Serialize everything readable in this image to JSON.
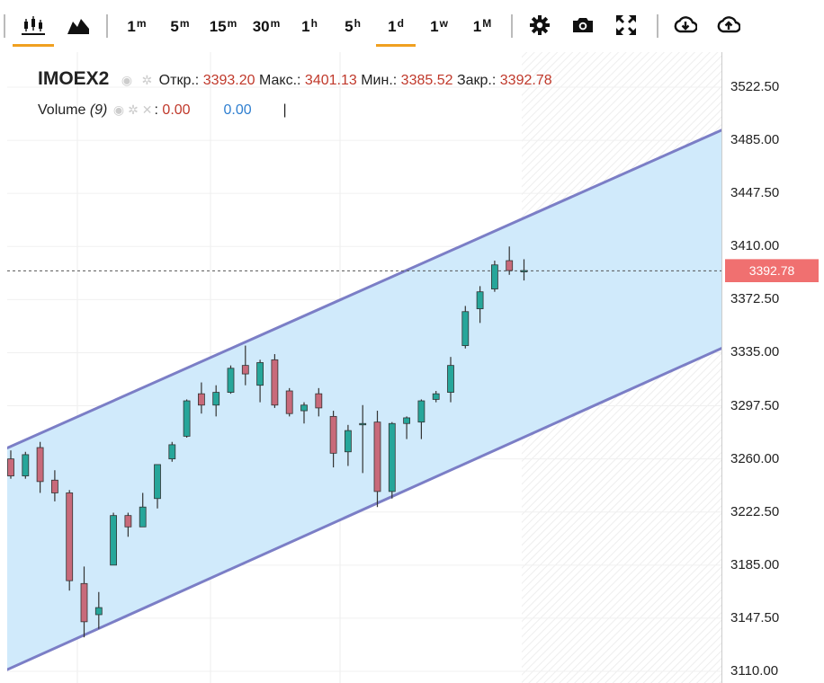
{
  "toolbar": {
    "chart_type_buttons": [
      {
        "icon": "candlestick-icon",
        "active": true
      },
      {
        "icon": "area-chart-icon",
        "active": false
      }
    ],
    "intervals": [
      {
        "main": "1",
        "sup": "m",
        "active": false
      },
      {
        "main": "5",
        "sup": "m",
        "active": false
      },
      {
        "main": "15",
        "sup": "m",
        "active": false
      },
      {
        "main": "30",
        "sup": "m",
        "active": false
      },
      {
        "main": "1",
        "sup": "h",
        "active": false
      },
      {
        "main": "5",
        "sup": "h",
        "active": false
      },
      {
        "main": "1",
        "sup": "d",
        "active": true
      },
      {
        "main": "1",
        "sup": "w",
        "active": false
      },
      {
        "main": "1",
        "sup": "M",
        "active": false
      }
    ],
    "tools": [
      "gear-icon",
      "camera-icon",
      "fullscreen-icon",
      "download-icon",
      "upload-icon"
    ]
  },
  "legend": {
    "symbol": "IMOEX2",
    "open_label": "Откр.:",
    "open": "3393.20",
    "high_label": "Макс.:",
    "high": "3401.13",
    "low_label": "Мин.:",
    "low": "3385.52",
    "close_label": "Закр.:",
    "close": "3392.78",
    "volume_label": "Volume",
    "volume_param": "(9)",
    "volume_value1": "0.00",
    "volume_value2": "0.00",
    "cursor": "|"
  },
  "axis": {
    "current_price": "3392.78",
    "ticks": [
      "3522.50",
      "3485.00",
      "3447.50",
      "3410.00",
      "3372.50",
      "3335.00",
      "3297.50",
      "3260.00",
      "3222.50",
      "3185.00",
      "3147.50",
      "3110.00"
    ]
  },
  "colors": {
    "up": "#26a69a",
    "down": "#c86a7a",
    "channel_fill": "#cde9fb",
    "channel_line": "#7b7ec6",
    "accent": "#f0a020",
    "price_tag": "#f07070"
  },
  "chart_data": {
    "type": "candlestick",
    "interval": "1d",
    "y_range": [
      3110.0,
      3522.5
    ],
    "candles": [
      {
        "o": 3260,
        "h": 3266,
        "l": 3246,
        "c": 3248
      },
      {
        "o": 3248,
        "h": 3265,
        "l": 3246,
        "c": 3263
      },
      {
        "o": 3268,
        "h": 3272,
        "l": 3236,
        "c": 3244
      },
      {
        "o": 3245,
        "h": 3252,
        "l": 3230,
        "c": 3236
      },
      {
        "o": 3236,
        "h": 3238,
        "l": 3167,
        "c": 3174
      },
      {
        "o": 3172,
        "h": 3184,
        "l": 3134,
        "c": 3145
      },
      {
        "o": 3150,
        "h": 3166,
        "l": 3140,
        "c": 3155
      },
      {
        "o": 3185,
        "h": 3222,
        "l": 3185,
        "c": 3220
      },
      {
        "o": 3220,
        "h": 3222,
        "l": 3205,
        "c": 3212
      },
      {
        "o": 3212,
        "h": 3236,
        "l": 3212,
        "c": 3226
      },
      {
        "o": 3232,
        "h": 3256,
        "l": 3225,
        "c": 3256
      },
      {
        "o": 3260,
        "h": 3272,
        "l": 3258,
        "c": 3270
      },
      {
        "o": 3276,
        "h": 3302,
        "l": 3275,
        "c": 3301
      },
      {
        "o": 3306,
        "h": 3314,
        "l": 3292,
        "c": 3298
      },
      {
        "o": 3298,
        "h": 3312,
        "l": 3290,
        "c": 3307
      },
      {
        "o": 3307,
        "h": 3326,
        "l": 3306,
        "c": 3324
      },
      {
        "o": 3326,
        "h": 3340,
        "l": 3312,
        "c": 3320
      },
      {
        "o": 3312,
        "h": 3330,
        "l": 3300,
        "c": 3328
      },
      {
        "o": 3330,
        "h": 3334,
        "l": 3296,
        "c": 3298
      },
      {
        "o": 3308,
        "h": 3310,
        "l": 3290,
        "c": 3292
      },
      {
        "o": 3294,
        "h": 3300,
        "l": 3285,
        "c": 3298
      },
      {
        "o": 3306,
        "h": 3310,
        "l": 3290,
        "c": 3296
      },
      {
        "o": 3290,
        "h": 3294,
        "l": 3254,
        "c": 3264
      },
      {
        "o": 3265,
        "h": 3284,
        "l": 3255,
        "c": 3280
      },
      {
        "o": 3285,
        "h": 3298,
        "l": 3250,
        "c": 3285
      },
      {
        "o": 3286,
        "h": 3294,
        "l": 3226,
        "c": 3237
      },
      {
        "o": 3237,
        "h": 3286,
        "l": 3232,
        "c": 3285
      },
      {
        "o": 3285,
        "h": 3290,
        "l": 3274,
        "c": 3289
      },
      {
        "o": 3286,
        "h": 3302,
        "l": 3274,
        "c": 3301
      },
      {
        "o": 3302,
        "h": 3308,
        "l": 3300,
        "c": 3306
      },
      {
        "o": 3307,
        "h": 3332,
        "l": 3300,
        "c": 3326
      },
      {
        "o": 3340,
        "h": 3368,
        "l": 3338,
        "c": 3364
      },
      {
        "o": 3366,
        "h": 3382,
        "l": 3356,
        "c": 3378
      },
      {
        "o": 3380,
        "h": 3400,
        "l": 3378,
        "c": 3397
      },
      {
        "o": 3400,
        "h": 3410,
        "l": 3390,
        "c": 3393
      },
      {
        "o": 3393,
        "h": 3401,
        "l": 3386,
        "c": 3393
      }
    ],
    "channel": {
      "upper": [
        {
          "i": -0.5,
          "price": 3266.5
        },
        {
          "i": 49.2,
          "price": 3495.5
        }
      ],
      "lower": [
        {
          "i": -0.5,
          "price": 3110.0
        },
        {
          "i": 49.2,
          "price": 3341.5
        }
      ]
    },
    "current_price": 3392.78
  }
}
